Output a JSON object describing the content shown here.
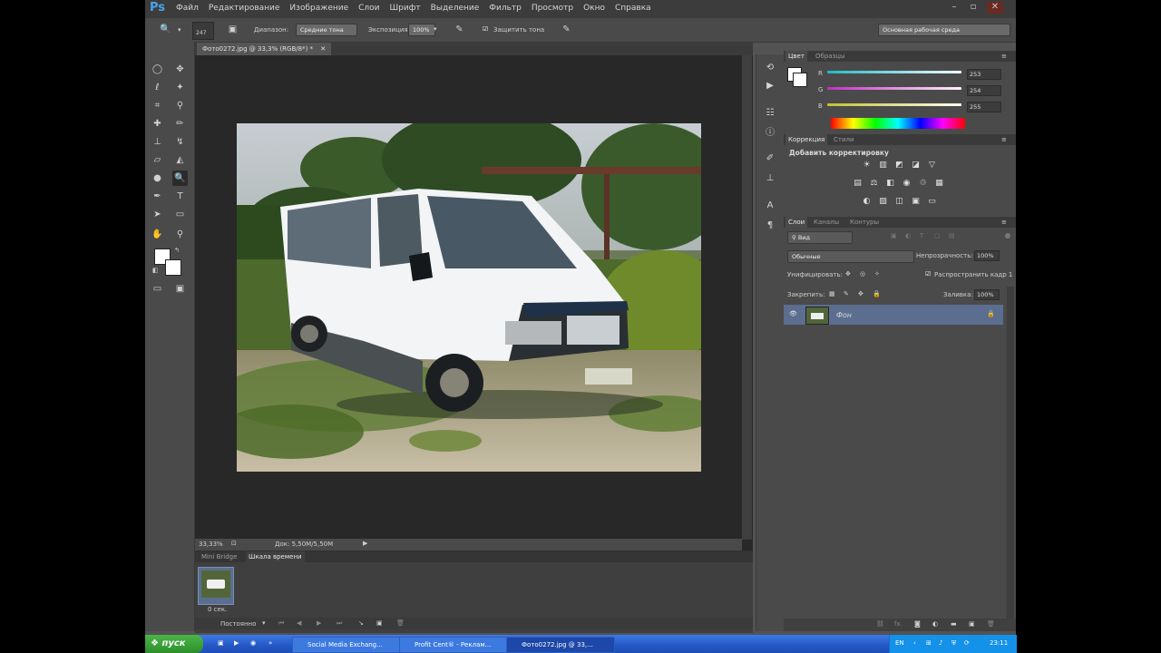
{
  "app": {
    "logo": "Ps",
    "menu": [
      "Файл",
      "Редактирование",
      "Изображение",
      "Слои",
      "Шрифт",
      "Выделение",
      "Фильтр",
      "Просмотр",
      "Окно",
      "Справка"
    ],
    "window_controls": [
      "–",
      "▫",
      "✕"
    ]
  },
  "options_bar": {
    "brush_size": "247",
    "range_label": "Диапазон:",
    "range_value": "Средние тона",
    "exposure_label": "Экспозиция:",
    "exposure_value": "100%",
    "protect_tones": "Защитить тона",
    "workspace": "Основная рабочая среда"
  },
  "document": {
    "tab_title": "Фото0272.jpg @ 33,3% (RGB/8*) *",
    "zoom": "33,33%",
    "doc_info": "Док: 5,50M/5,50M"
  },
  "bottom_panel": {
    "tabs": [
      "Mini Bridge",
      "Шкала времени"
    ],
    "frame_time": "0 сек.",
    "loop_mode": "Постоянно"
  },
  "color_panel": {
    "tabs": [
      "Цвет",
      "Образцы"
    ],
    "channels": [
      {
        "label": "R",
        "value": "253",
        "color": "#44d7d7"
      },
      {
        "label": "G",
        "value": "254",
        "color": "#d24ad2"
      },
      {
        "label": "B",
        "value": "255",
        "color": "#d7d44a"
      }
    ]
  },
  "adjustments_panel": {
    "tabs": [
      "Коррекция",
      "Стили"
    ],
    "title": "Добавить корректировку"
  },
  "layers_panel": {
    "tabs": [
      "Слои",
      "Каналы",
      "Контуры"
    ],
    "kind": "Вид",
    "blend_mode": "Обычные",
    "opacity_label": "Непрозрачность:",
    "opacity_value": "100%",
    "unify_label": "Унифицировать:",
    "propagate_label": "Распространить кадр 1",
    "lock_label": "Закрепить:",
    "fill_label": "Заливка:",
    "fill_value": "100%",
    "layers": [
      {
        "name": "Фон",
        "visible": true,
        "locked": true
      }
    ]
  },
  "taskbar": {
    "start": "пуск",
    "tasks": [
      {
        "label": "Social Media Exchang...",
        "active": false
      },
      {
        "label": "Profit Cent® - Реклам...",
        "active": false
      },
      {
        "label": "Фото0272.jpg @ 33,...",
        "active": true
      }
    ],
    "lang": "EN",
    "clock": "23:11"
  }
}
